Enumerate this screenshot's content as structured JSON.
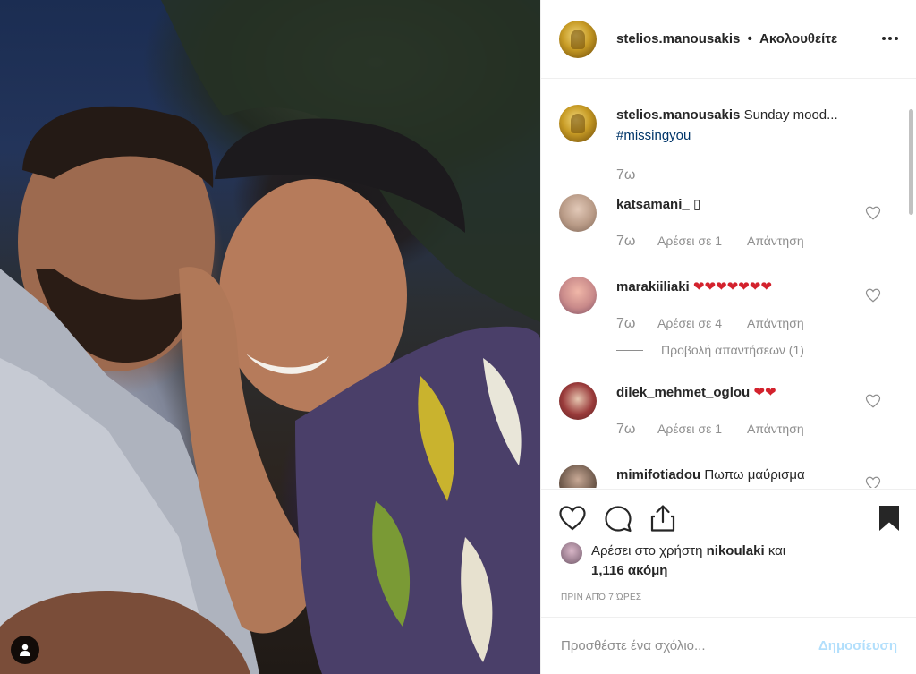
{
  "post": {
    "author": "stelios.manousakis",
    "follow_status": "Ακολουθείτε",
    "separator": "•"
  },
  "caption": {
    "username": "stelios.manousakis",
    "text": "Sunday mood...",
    "hashtag": "#missingyou",
    "time": "7ω"
  },
  "comments": [
    {
      "username": "katsamani_",
      "text": "▯",
      "time": "7ω",
      "likes": "Αρέσει σε 1",
      "reply": "Απάντηση",
      "avatar_color": "#b89a86"
    },
    {
      "username": "marakiiliaki",
      "text": "❤❤❤❤❤❤❤",
      "time": "7ω",
      "likes": "Αρέσει σε 4",
      "reply": "Απάντηση",
      "view_replies": "Προβολή απαντήσεων (1)",
      "avatar_color": "#c98a8a"
    },
    {
      "username": "dilek_mehmet_oglou",
      "text": "❤❤",
      "time": "7ω",
      "likes": "Αρέσει σε 1",
      "reply": "Απάντηση",
      "avatar_color": "#9a3b3b"
    },
    {
      "username": "mimifotiadou",
      "text": "Πωπω μαύρισμα",
      "avatar_color": "#6f5a4c"
    }
  ],
  "likes_summary": {
    "prefix": "Αρέσει στο χρήστη",
    "user": "nikoulaki",
    "and": "και",
    "others": "1,116 ακόμη"
  },
  "timestamp": "ΠΡΙΝ ΑΠΌ 7 ΏΡΕΣ",
  "add_comment": {
    "placeholder": "Προσθέστε ένα σχόλιο...",
    "post_label": "Δημοσίευση"
  },
  "icons": [
    "heart-icon",
    "comment-icon",
    "share-icon",
    "bookmark-icon",
    "more-icon",
    "user-tag-icon"
  ]
}
